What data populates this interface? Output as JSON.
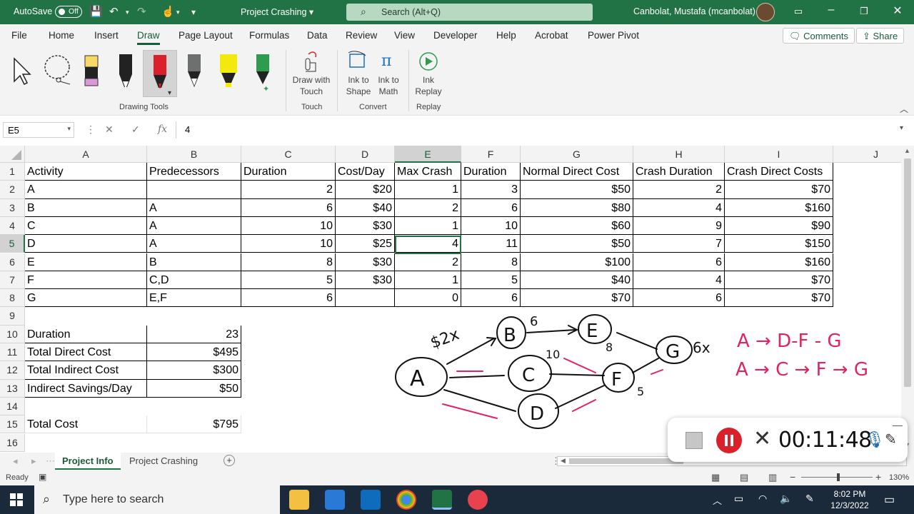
{
  "titlebar": {
    "autosave_label": "AutoSave",
    "autosave_state": "Off",
    "doc_title": "Project Crashing",
    "search_placeholder": "Search (Alt+Q)",
    "user": "Canbolat, Mustafa (mcanbolat)"
  },
  "menu": {
    "tabs": [
      "File",
      "Home",
      "Insert",
      "Draw",
      "Page Layout",
      "Formulas",
      "Data",
      "Review",
      "View",
      "Developer",
      "Help",
      "Acrobat",
      "Power Pivot"
    ],
    "active_tab": "Draw",
    "comments_label": "Comments",
    "share_label": "Share"
  },
  "ribbon": {
    "drawing_tools_label": "Drawing Tools",
    "draw_with_touch_label": "Draw with Touch",
    "touch_group": "Touch",
    "ink_to_shape_label": "Ink to Shape",
    "ink_to_math_label": "Ink to Math",
    "convert_group": "Convert",
    "ink_replay_label": "Ink Replay",
    "replay_group": "Replay"
  },
  "formula_bar": {
    "name_box": "E5",
    "fx": "fx",
    "value": "4"
  },
  "grid": {
    "columns": [
      "A",
      "B",
      "C",
      "D",
      "E",
      "F",
      "G",
      "H",
      "I",
      "J"
    ],
    "selected_column": "E",
    "row_numbers": [
      "1",
      "2",
      "3",
      "4",
      "5",
      "6",
      "7",
      "8",
      "9",
      "10",
      "11",
      "12",
      "13",
      "14",
      "15",
      "16"
    ],
    "selected_row": "5",
    "headers": [
      "Activity",
      "Predecessors",
      "Duration",
      "Cost/Day",
      "Max Crash",
      "Duration",
      "Normal Direct Cost",
      "Crash Duration",
      "Crash Direct Costs"
    ],
    "rows": [
      [
        "A",
        "",
        "2",
        "$20",
        "1",
        "3",
        "$50",
        "2",
        "$70"
      ],
      [
        "B",
        "A",
        "6",
        "$40",
        "2",
        "6",
        "$80",
        "4",
        "$160"
      ],
      [
        "C",
        "A",
        "10",
        "$30",
        "1",
        "10",
        "$60",
        "9",
        "$90"
      ],
      [
        "D",
        "A",
        "10",
        "$25",
        "4",
        "11",
        "$50",
        "7",
        "$150"
      ],
      [
        "E",
        "B",
        "8",
        "$30",
        "2",
        "8",
        "$100",
        "6",
        "$160"
      ],
      [
        "F",
        "C,D",
        "5",
        "$30",
        "1",
        "5",
        "$40",
        "4",
        "$70"
      ],
      [
        "G",
        "E,F",
        "6",
        "",
        "0",
        "6",
        "$70",
        "6",
        "$70"
      ]
    ],
    "summary": [
      {
        "label": "Duration",
        "value": "23"
      },
      {
        "label": "Total Direct Cost",
        "value": "$495"
      },
      {
        "label": "Total Indirect Cost",
        "value": "$300"
      },
      {
        "label": "Indirect Savings/Day",
        "value": "$50"
      }
    ],
    "total_label": "Total Cost",
    "total_value": "$795"
  },
  "ink": {
    "nodes": [
      "A",
      "B",
      "C",
      "D",
      "E",
      "F",
      "G"
    ],
    "annotations": [
      "$2x",
      "6",
      "10",
      "8",
      "5",
      "6x"
    ],
    "paths": [
      "A → D-F - G",
      "A → C → F → G"
    ],
    "ink_color_black": "#111111",
    "ink_color_red": "#e0245e"
  },
  "sheets": {
    "tabs": [
      "Project Info",
      "Project Crashing"
    ],
    "active": "Project Info"
  },
  "status": {
    "ready": "Ready",
    "zoom": "130%"
  },
  "recorder": {
    "time": "00:11:48"
  },
  "taskbar": {
    "search_placeholder": "Type here to search",
    "time": "8:02 PM",
    "date": "12/3/2022"
  },
  "colors": {
    "accent": "#217346",
    "accent_dark": "#185c37"
  }
}
